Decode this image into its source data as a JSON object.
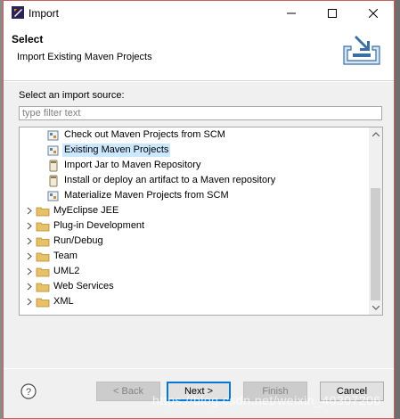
{
  "window": {
    "title": "Import"
  },
  "header": {
    "title": "Select",
    "description": "Import Existing Maven Projects"
  },
  "source": {
    "label": "Select an import source:",
    "filter_placeholder": "type filter text"
  },
  "tree": {
    "items": [
      {
        "label": "Check out Maven Projects from SCM",
        "icon": "maven-project-icon",
        "level": 1
      },
      {
        "label": "Existing Maven Projects",
        "icon": "maven-project-icon",
        "level": 1,
        "selected": true
      },
      {
        "label": "Import Jar to Maven Repository",
        "icon": "jar-icon",
        "level": 1
      },
      {
        "label": "Install or deploy an artifact to a Maven repository",
        "icon": "jar-icon",
        "level": 1
      },
      {
        "label": "Materialize Maven Projects from SCM",
        "icon": "maven-project-icon",
        "level": 1
      },
      {
        "label": "MyEclipse JEE",
        "icon": "folder-icon",
        "level": 0
      },
      {
        "label": "Plug-in Development",
        "icon": "folder-icon",
        "level": 0
      },
      {
        "label": "Run/Debug",
        "icon": "folder-icon",
        "level": 0
      },
      {
        "label": "Team",
        "icon": "folder-icon",
        "level": 0
      },
      {
        "label": "UML2",
        "icon": "folder-icon",
        "level": 0
      },
      {
        "label": "Web Services",
        "icon": "folder-icon",
        "level": 0
      },
      {
        "label": "XML",
        "icon": "folder-icon",
        "level": 0
      }
    ]
  },
  "buttons": {
    "back": "< Back",
    "next": "Next >",
    "finish": "Finish",
    "cancel": "Cancel"
  },
  "watermark": "https://blog.csdn.net/weixin_40307206",
  "colors": {
    "selection": "#cce8ff",
    "folder": "#e8c068",
    "default_button_border": "#0078d7"
  }
}
